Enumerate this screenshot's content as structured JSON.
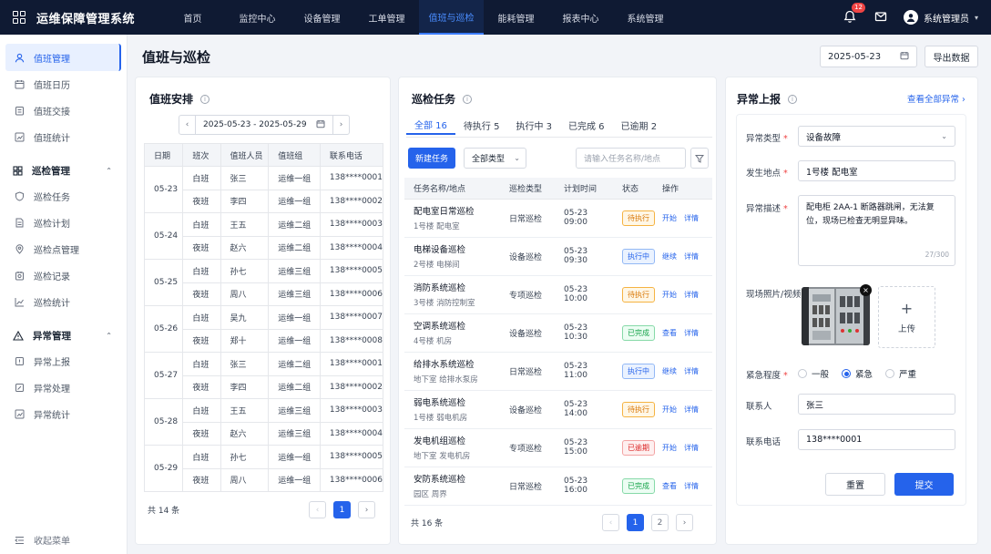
{
  "app": {
    "title": "运维保障管理系统"
  },
  "nav": [
    "首页",
    "监控中心",
    "设备管理",
    "工单管理",
    "值班与巡检",
    "能耗管理",
    "报表中心",
    "系统管理"
  ],
  "header": {
    "notif_count": "12",
    "user": "系统管理员"
  },
  "sidebar": {
    "active": "值班管理",
    "duty_items": [
      "值班日历",
      "值班交接",
      "值班统计"
    ],
    "inspect_group": "巡检管理",
    "inspect_items": [
      "巡检任务",
      "巡检计划",
      "巡检点管理",
      "巡检记录",
      "巡检统计"
    ],
    "abnormal_group": "异常管理",
    "abnormal_items": [
      "异常上报",
      "异常处理",
      "异常统计"
    ],
    "collapse": "收起菜单"
  },
  "page": {
    "title": "值班与巡检",
    "date": "2025-05-23",
    "export": "导出数据"
  },
  "duty": {
    "title": "值班安排",
    "range": "2025-05-23 - 2025-05-29",
    "headers": [
      "日期",
      "班次",
      "值班人员",
      "值班组",
      "联系电话"
    ],
    "days": [
      {
        "date": "05-23",
        "rows": [
          [
            "白班",
            "张三",
            "运维一组",
            "138****0001"
          ],
          [
            "夜班",
            "李四",
            "运维一组",
            "138****0002"
          ]
        ]
      },
      {
        "date": "05-24",
        "rows": [
          [
            "白班",
            "王五",
            "运维二组",
            "138****0003"
          ],
          [
            "夜班",
            "赵六",
            "运维二组",
            "138****0004"
          ]
        ]
      },
      {
        "date": "05-25",
        "rows": [
          [
            "白班",
            "孙七",
            "运维三组",
            "138****0005"
          ],
          [
            "夜班",
            "周八",
            "运维三组",
            "138****0006"
          ]
        ]
      },
      {
        "date": "05-26",
        "rows": [
          [
            "白班",
            "吴九",
            "运维一组",
            "138****0007"
          ],
          [
            "夜班",
            "郑十",
            "运维一组",
            "138****0008"
          ]
        ]
      },
      {
        "date": "05-27",
        "rows": [
          [
            "白班",
            "张三",
            "运维二组",
            "138****0001"
          ],
          [
            "夜班",
            "李四",
            "运维二组",
            "138****0002"
          ]
        ]
      },
      {
        "date": "05-28",
        "rows": [
          [
            "白班",
            "王五",
            "运维三组",
            "138****0003"
          ],
          [
            "夜班",
            "赵六",
            "运维三组",
            "138****0004"
          ]
        ]
      },
      {
        "date": "05-29",
        "rows": [
          [
            "白班",
            "孙七",
            "运维一组",
            "138****0005"
          ],
          [
            "夜班",
            "周八",
            "运维一组",
            "138****0006"
          ]
        ]
      }
    ],
    "total": "共 14 条",
    "page": "1"
  },
  "tasks": {
    "title": "巡检任务",
    "tabs": [
      "全部 16",
      "待执行 5",
      "执行中 3",
      "已完成 6",
      "已逾期 2"
    ],
    "new_btn": "新建任务",
    "type_filter": "全部类型",
    "search_placeholder": "请输入任务名称/地点",
    "headers": [
      "任务名称/地点",
      "巡检类型",
      "计划时间",
      "状态",
      "操作"
    ],
    "rows": [
      {
        "name": "配电室日常巡检",
        "loc": "1号楼 配电室",
        "type": "日常巡检",
        "time": "05-23 09:00",
        "status": "待执行",
        "kind": "pending",
        "op": "开始",
        "detail": "详情"
      },
      {
        "name": "电梯设备巡检",
        "loc": "2号楼 电梯间",
        "type": "设备巡检",
        "time": "05-23 09:30",
        "status": "执行中",
        "kind": "running",
        "op": "继续",
        "detail": "详情"
      },
      {
        "name": "消防系统巡检",
        "loc": "3号楼 消防控制室",
        "type": "专项巡检",
        "time": "05-23 10:00",
        "status": "待执行",
        "kind": "pending",
        "op": "开始",
        "detail": "详情"
      },
      {
        "name": "空调系统巡检",
        "loc": "4号楼 机房",
        "type": "设备巡检",
        "time": "05-23 10:30",
        "status": "已完成",
        "kind": "done",
        "op": "查看",
        "detail": "详情"
      },
      {
        "name": "给排水系统巡检",
        "loc": "地下室 给排水泵房",
        "type": "日常巡检",
        "time": "05-23 11:00",
        "status": "执行中",
        "kind": "running",
        "op": "继续",
        "detail": "详情"
      },
      {
        "name": "弱电系统巡检",
        "loc": "1号楼 弱电机房",
        "type": "设备巡检",
        "time": "05-23 14:00",
        "status": "待执行",
        "kind": "pending",
        "op": "开始",
        "detail": "详情"
      },
      {
        "name": "发电机组巡检",
        "loc": "地下室 发电机房",
        "type": "专项巡检",
        "time": "05-23 15:00",
        "status": "已逾期",
        "kind": "overdue",
        "op": "开始",
        "detail": "详情"
      },
      {
        "name": "安防系统巡检",
        "loc": "园区 周界",
        "type": "日常巡检",
        "time": "05-23 16:00",
        "status": "已完成",
        "kind": "done",
        "op": "查看",
        "detail": "详情"
      }
    ],
    "total": "共 16 条",
    "pages": [
      "1",
      "2"
    ]
  },
  "report": {
    "title": "异常上报",
    "view_all": "查看全部异常",
    "type_label": "异常类型",
    "type_value": "设备故障",
    "loc_label": "发生地点",
    "loc_value": "1号楼 配电室",
    "desc_label": "异常描述",
    "desc_value": "配电柜 2AA-1 断路器跳闸，无法复位，现场已检查无明显异味。",
    "desc_count": "27/300",
    "photo_label": "现场照片/视频",
    "upload": "上传",
    "urgency_label": "紧急程度",
    "urgency_options": [
      "一般",
      "紧急",
      "严重"
    ],
    "urgency_selected": 1,
    "contact_label": "联系人",
    "contact_value": "张三",
    "phone_label": "联系电话",
    "phone_value": "138****0001",
    "reset": "重置",
    "submit": "提交"
  },
  "colors": {
    "accent": "#2563eb",
    "topbar": "#0f1a33",
    "pending": "#f59e0b",
    "running": "#3b82f6",
    "done": "#22c55e",
    "overdue": "#ef4444"
  }
}
